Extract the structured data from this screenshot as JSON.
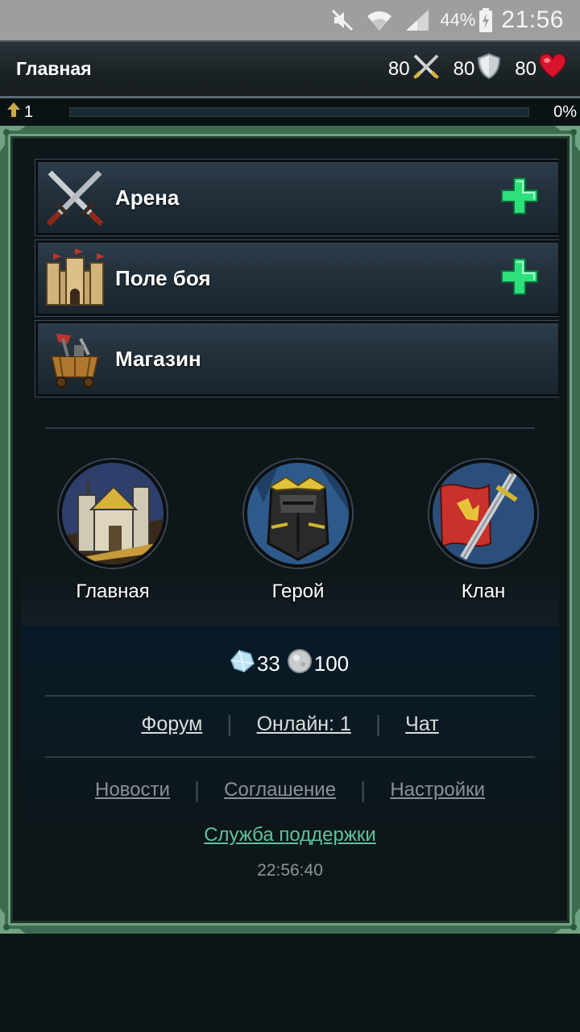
{
  "status_bar": {
    "battery": "44%",
    "time": "21:56",
    "icons": [
      "mute-icon",
      "wifi-icon",
      "signal-icon",
      "battery-charging-icon"
    ]
  },
  "header": {
    "title": "Главная",
    "attack": "80",
    "defense": "80",
    "health": "80"
  },
  "xp": {
    "level": "1",
    "progress_percent": 0,
    "percent_label": "0%"
  },
  "menu": [
    {
      "label": "Арена",
      "icon": "crossed-swords-icon",
      "has_plus": true
    },
    {
      "label": "Поле боя",
      "icon": "castle-icon",
      "has_plus": true
    },
    {
      "label": "Магазин",
      "icon": "shop-cart-icon",
      "has_plus": false
    }
  ],
  "nav": [
    {
      "label": "Главная",
      "icon": "castle-emblem-icon"
    },
    {
      "label": "Герой",
      "icon": "knight-helmet-icon"
    },
    {
      "label": "Клан",
      "icon": "clan-flag-sword-icon"
    }
  ],
  "currency": {
    "diamonds": "33",
    "silver": "100"
  },
  "links": {
    "forum": "Форум",
    "online": "Онлайн: 1",
    "chat": "Чат",
    "news": "Новости",
    "agreement": "Соглашение",
    "settings": "Настройки",
    "support": "Служба поддержки"
  },
  "server_time": "22:56:40",
  "colors": {
    "frame_green": "#3c6b4f",
    "plus_green": "#2ee07a",
    "support_link": "#5fc29a"
  }
}
